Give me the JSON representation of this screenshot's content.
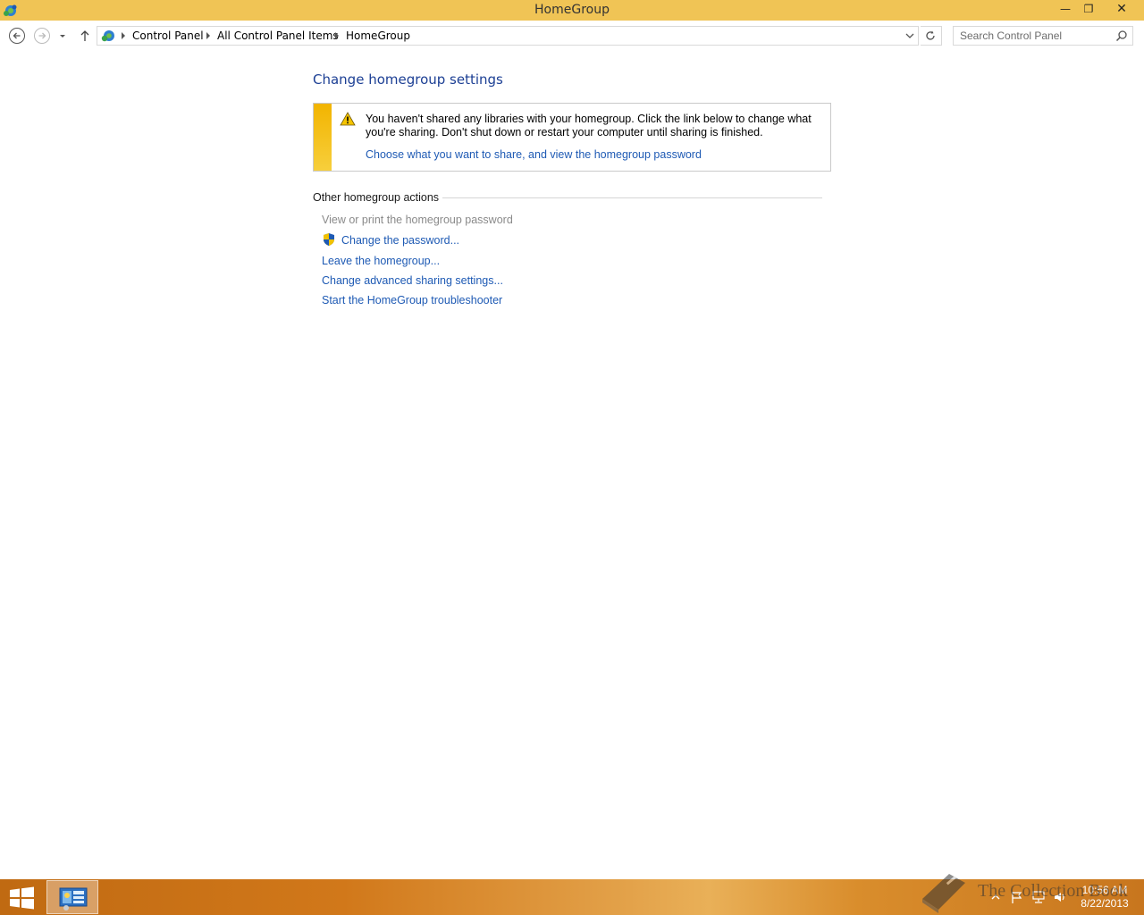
{
  "window": {
    "title": "HomeGroup",
    "controls": {
      "minimize": "—",
      "restore": "❐",
      "close": "✕"
    }
  },
  "navbar": {
    "breadcrumbs": [
      "Control Panel",
      "All Control Panel Items",
      "HomeGroup"
    ],
    "search_placeholder": "Search Control Panel"
  },
  "main": {
    "title": "Change homegroup settings",
    "warning": {
      "message": "You haven't shared any libraries with your homegroup. Click the link below to change what you're sharing. Don't shut down or restart your computer until sharing is finished.",
      "link": "Choose what you want to share, and view the homegroup password"
    },
    "other_actions": {
      "heading": "Other homegroup actions",
      "items": [
        {
          "label": "View or print the homegroup password",
          "enabled": false
        },
        {
          "label": "Change the password...",
          "enabled": true,
          "icon": "uac-shield-icon"
        },
        {
          "label": "Leave the homegroup...",
          "enabled": true
        },
        {
          "label": "Change advanced sharing settings...",
          "enabled": true
        },
        {
          "label": "Start the HomeGroup troubleshooter",
          "enabled": true
        }
      ]
    }
  },
  "taskbar": {
    "time": "10:56 AM",
    "date": "8/22/2013"
  },
  "watermark": {
    "text": "The Collection Book"
  },
  "colors": {
    "titlebar": "#f0c455",
    "link": "#1e5ab4",
    "title": "#1c3f94",
    "warning_stripe": "#f2b400"
  }
}
